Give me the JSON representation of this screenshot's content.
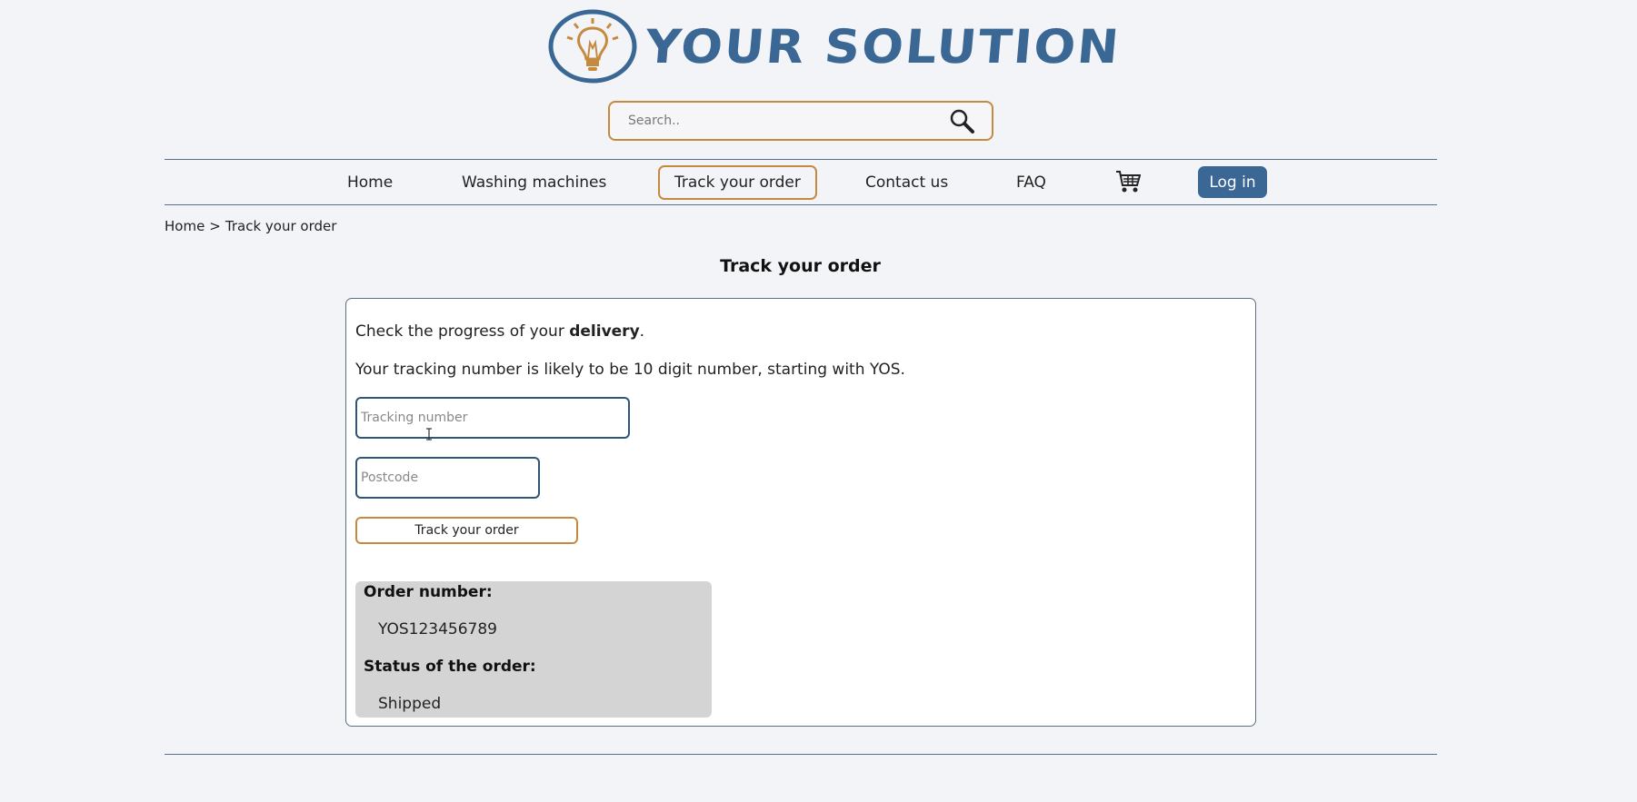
{
  "brand": {
    "name": "YOUR SOLUTION",
    "colors": {
      "primary": "#3a6794",
      "accent": "#c68a3f",
      "background": "#f3f4f8"
    },
    "logo_icon": "lightbulb-icon"
  },
  "search": {
    "placeholder": "Search..",
    "icon": "magnifier-icon"
  },
  "nav": {
    "items": [
      {
        "label": "Home",
        "active": false
      },
      {
        "label": "Washing machines",
        "active": false
      },
      {
        "label": "Track your order",
        "active": true
      },
      {
        "label": "Contact us",
        "active": false
      },
      {
        "label": "FAQ",
        "active": false
      }
    ],
    "cart_icon": "cart-icon",
    "login_label": "Log in"
  },
  "breadcrumb": {
    "home": "Home",
    "separator": ">",
    "current": "Track your order"
  },
  "page": {
    "title": "Track your order",
    "intro_prefix": "Check the progress of your ",
    "intro_bold": "delivery",
    "intro_suffix": ".",
    "hint": "Your tracking number is likely to be 10 digit number, starting with YOS."
  },
  "form": {
    "tracking_placeholder": "Tracking number",
    "postcode_placeholder": "Postcode",
    "submit_label": "Track your order"
  },
  "result": {
    "order_label": "Order number:",
    "order_value": "YOS123456789",
    "status_label": "Status of the order:",
    "status_value": "Shipped"
  }
}
